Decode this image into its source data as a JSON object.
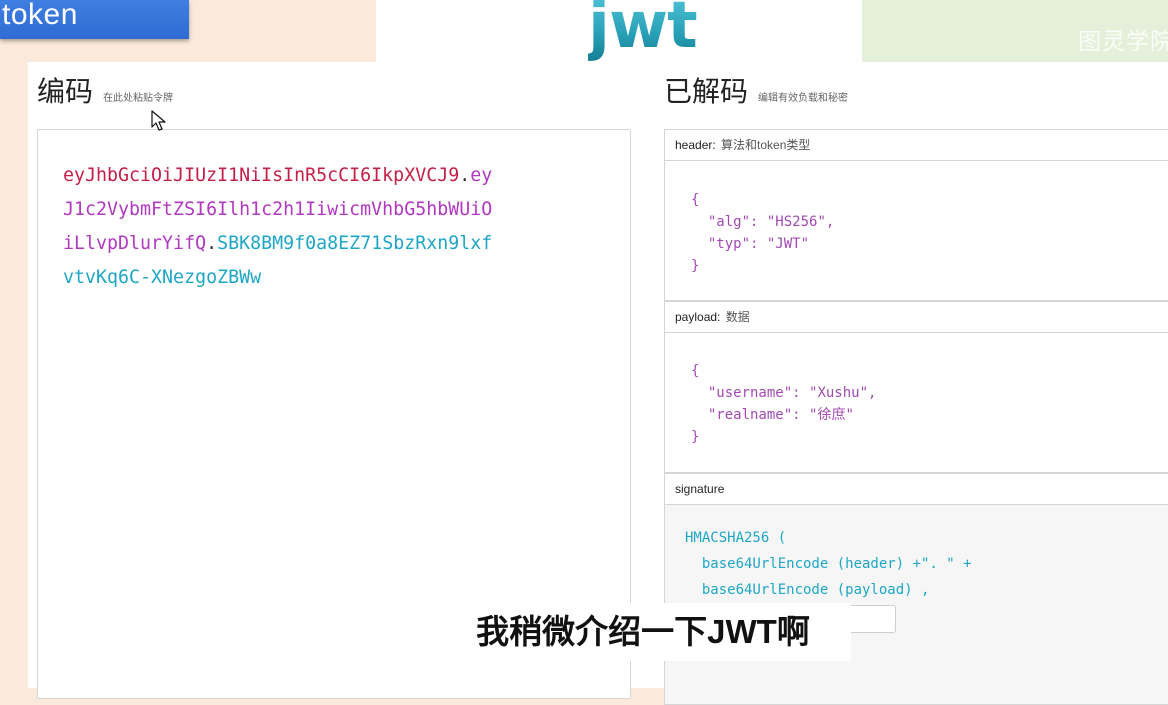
{
  "top": {
    "token_label": "token",
    "logo_text": "jwt",
    "watermark": "图灵学院"
  },
  "encoded": {
    "title": "编码",
    "hint": "在此处粘贴令牌",
    "lines": [
      [
        {
          "t": "eyJhbGciOiJIUzI1NiIsInR5cCI6IkpXVCJ9",
          "part": "header"
        },
        {
          "t": ".",
          "part": "dot"
        },
        {
          "t": "ey",
          "part": "payload"
        }
      ],
      [
        {
          "t": "J1c2VybmFtZSI6Ilh1c2h1IiwicmVhbG5hbWUiO",
          "part": "payload"
        }
      ],
      [
        {
          "t": "iLlvpDlurYifQ",
          "part": "payload"
        },
        {
          "t": ".",
          "part": "dot"
        },
        {
          "t": "SBK8BM9f0a8EZ71SbzRxn9lxf",
          "part": "signature"
        }
      ],
      [
        {
          "t": "vtvKq6C-XNezgoZBWw",
          "part": "signature"
        }
      ]
    ]
  },
  "decoded": {
    "title": "已解码",
    "hint": "编辑有效负载和秘密",
    "header": {
      "label": "header:",
      "desc": "算法和token类型",
      "json": [
        [
          "{"
        ],
        [
          "  \"alg\"",
          ": ",
          "\"HS256\"",
          ","
        ],
        [
          "  \"typ\"",
          ": ",
          "\"JWT\""
        ],
        [
          "}"
        ]
      ]
    },
    "payload": {
      "label": "payload:",
      "desc": "数据",
      "json": [
        [
          "{"
        ],
        [
          "  \"username\"",
          ": ",
          "\"Xushu\"",
          ","
        ],
        [
          "  \"realname\"",
          ": ",
          "\"徐庶\""
        ],
        [
          "}"
        ]
      ]
    },
    "signature": {
      "label": "signature",
      "code": [
        "HMACSHA256 (",
        "  base64UrlEncode (header) +\". \" +",
        "  base64UrlEncode (payload) ,"
      ]
    }
  },
  "subtitle": "我稍微介绍一下JWT啊",
  "colors": {
    "header_part": "#c31f47",
    "payload_part": "#b138c0",
    "signature_part": "#1ea6c6",
    "logo": "#2aa6bd",
    "tab_blue": "#2f6bd3"
  }
}
